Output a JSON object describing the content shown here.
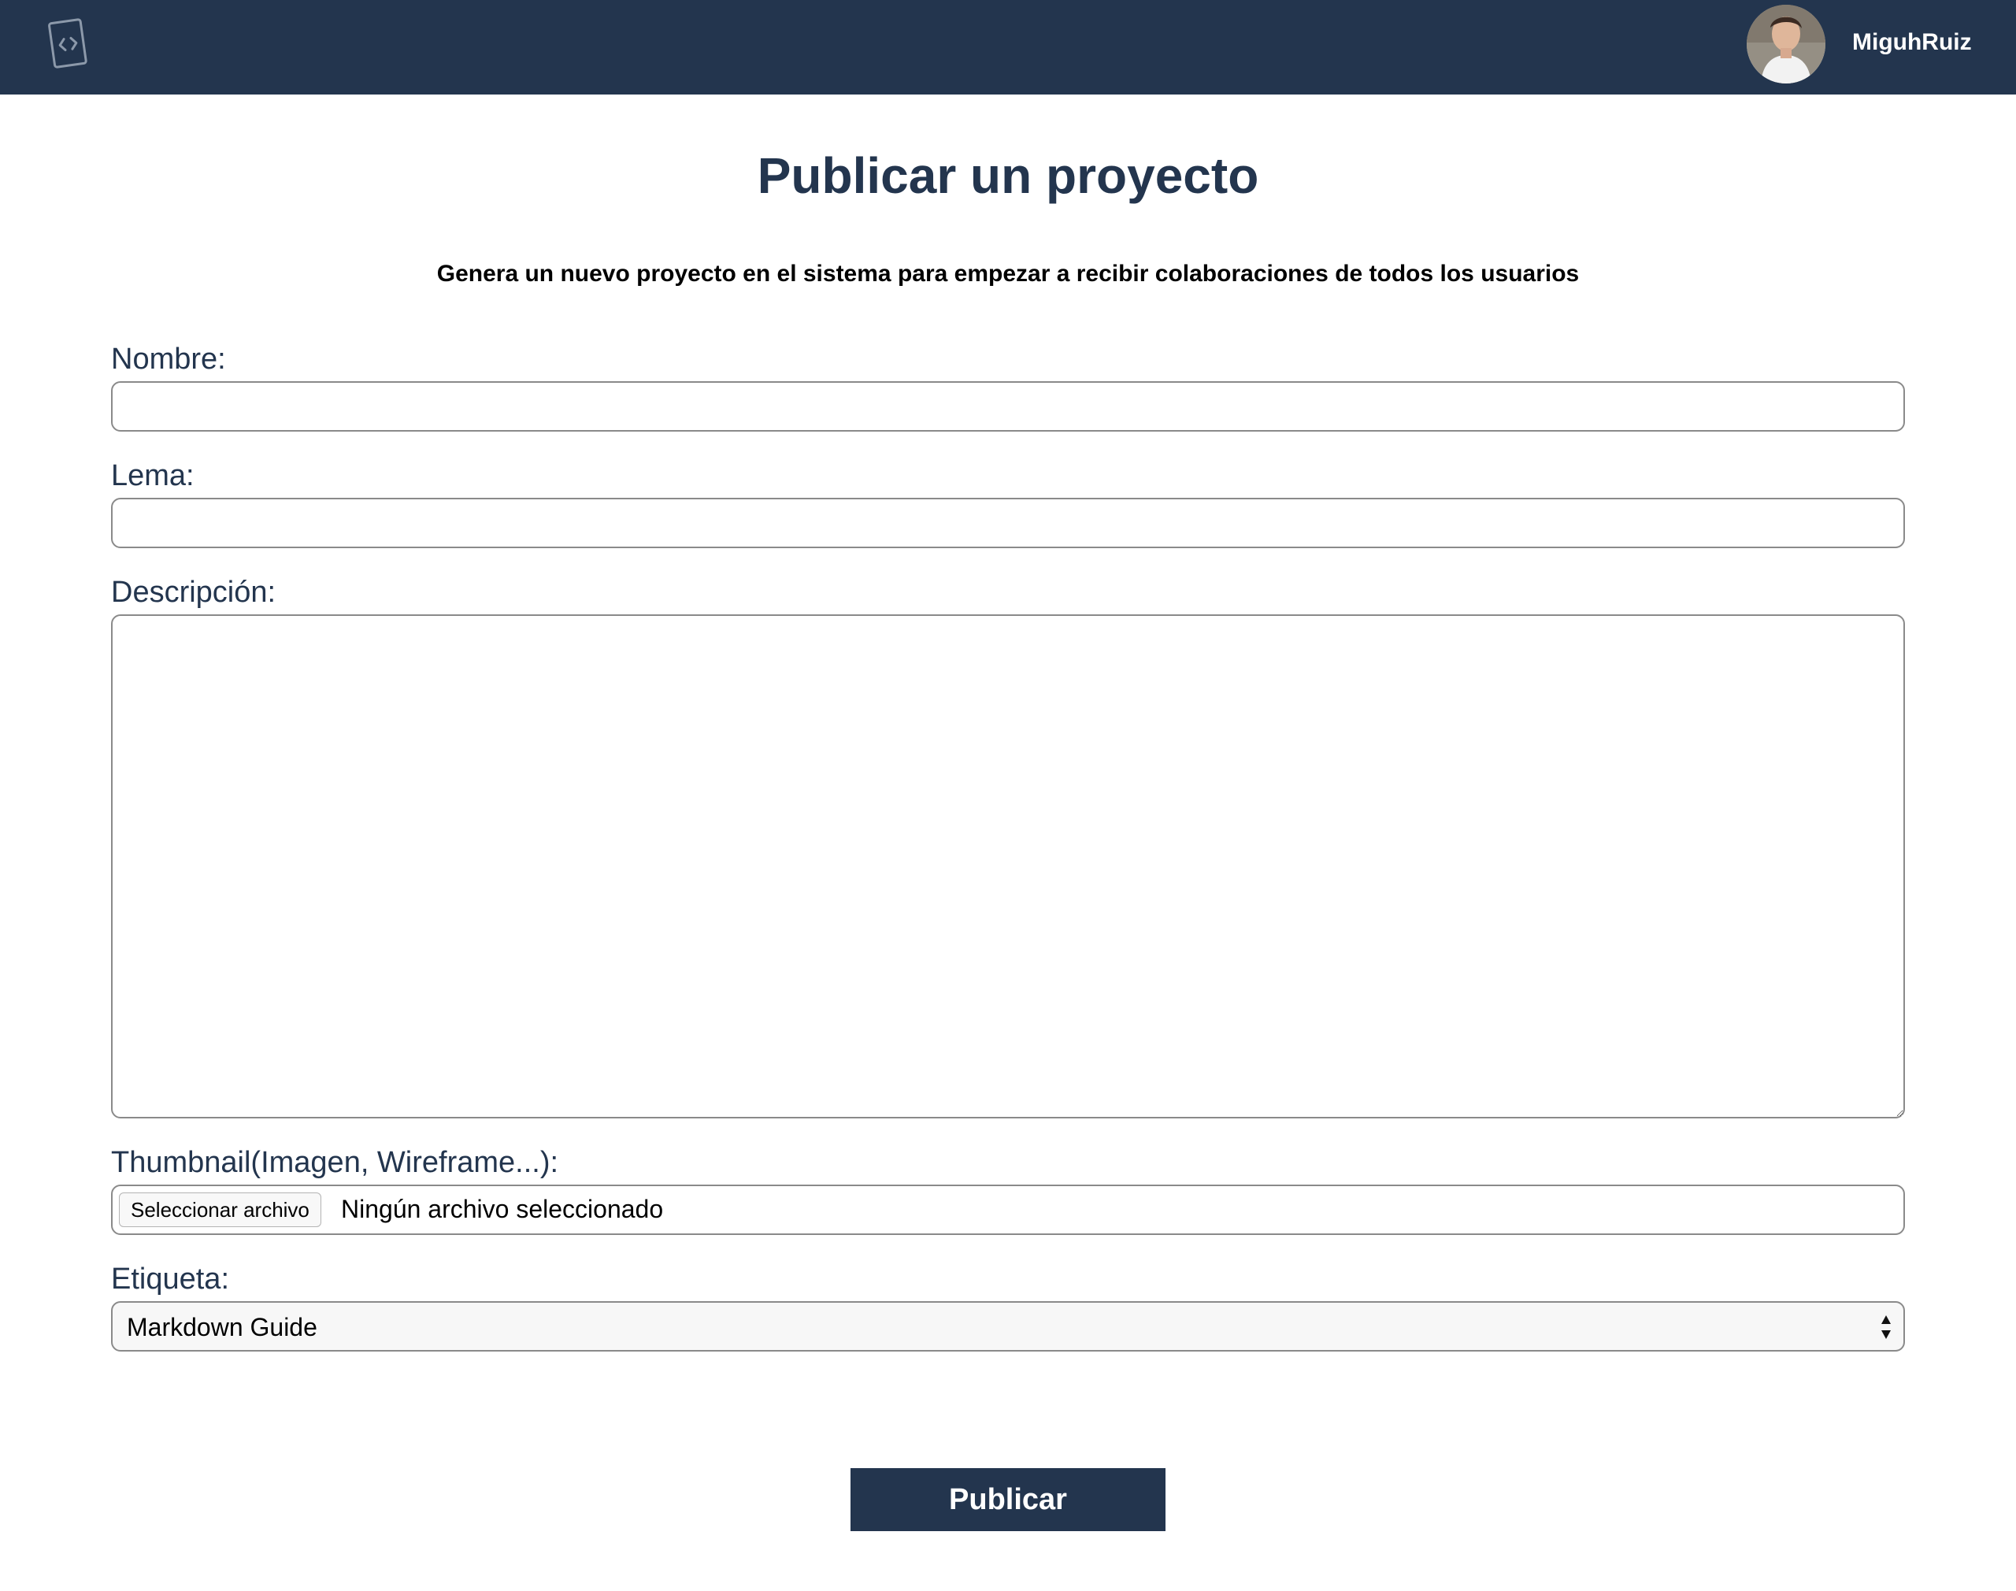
{
  "header": {
    "logo_icon": "code-card-icon",
    "user": {
      "avatar": "user-avatar",
      "name": "MiguhRuiz"
    }
  },
  "page": {
    "title": "Publicar un proyecto",
    "subtitle": "Genera un nuevo proyecto en el sistema para empezar a recibir colaboraciones de todos los usuarios"
  },
  "form": {
    "name": {
      "label": "Nombre:",
      "value": ""
    },
    "motto": {
      "label": "Lema:",
      "value": ""
    },
    "description": {
      "label": "Descripción:",
      "value": ""
    },
    "thumbnail": {
      "label": "Thumbnail(Imagen, Wireframe...):",
      "button_label": "Seleccionar archivo",
      "status": "Ningún archivo seleccionado"
    },
    "tag": {
      "label": "Etiqueta:",
      "selected": "Markdown Guide"
    },
    "submit_label": "Publicar"
  },
  "colors": {
    "primary": "#23354e",
    "border": "#8a8a8a",
    "select_background": "#f7f7f7"
  }
}
